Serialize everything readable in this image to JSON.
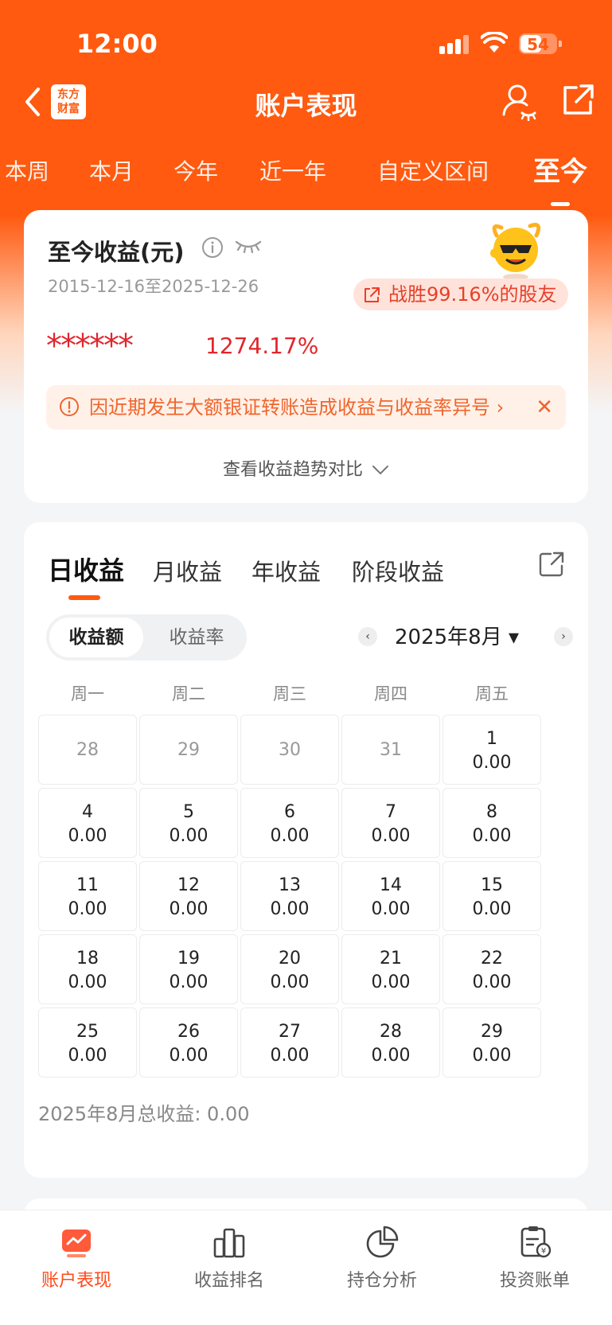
{
  "status": {
    "time": "12:00",
    "battery": "54"
  },
  "nav": {
    "logo": [
      "东方",
      "财富"
    ],
    "title": "账户表现"
  },
  "period_tabs": [
    "本周",
    "本月",
    "今年",
    "近一年",
    "自定义区间",
    "至今"
  ],
  "summary": {
    "title": "至今收益(元)",
    "range": "2015-12-16至2025-12-26",
    "badge": "战胜99.16%的股友",
    "hidden_amount": "******",
    "rate": "1274.17%",
    "notice": "因近期发生大额银证转账造成收益与收益率异号",
    "trend_link": "查看收益趋势对比"
  },
  "calendar": {
    "tabs": [
      "日收益",
      "月收益",
      "年收益",
      "阶段收益"
    ],
    "toggle": [
      "收益额",
      "收益率"
    ],
    "month": "2025年8月",
    "weekdays": [
      "周一",
      "周二",
      "周三",
      "周四",
      "周五"
    ],
    "weeks": [
      [
        {
          "d": "28",
          "v": ""
        },
        {
          "d": "29",
          "v": ""
        },
        {
          "d": "30",
          "v": ""
        },
        {
          "d": "31",
          "v": ""
        },
        {
          "d": "1",
          "v": "0.00"
        }
      ],
      [
        {
          "d": "4",
          "v": "0.00"
        },
        {
          "d": "5",
          "v": "0.00"
        },
        {
          "d": "6",
          "v": "0.00"
        },
        {
          "d": "7",
          "v": "0.00"
        },
        {
          "d": "8",
          "v": "0.00"
        }
      ],
      [
        {
          "d": "11",
          "v": "0.00"
        },
        {
          "d": "12",
          "v": "0.00"
        },
        {
          "d": "13",
          "v": "0.00"
        },
        {
          "d": "14",
          "v": "0.00"
        },
        {
          "d": "15",
          "v": "0.00"
        }
      ],
      [
        {
          "d": "18",
          "v": "0.00"
        },
        {
          "d": "19",
          "v": "0.00"
        },
        {
          "d": "20",
          "v": "0.00"
        },
        {
          "d": "21",
          "v": "0.00"
        },
        {
          "d": "22",
          "v": "0.00"
        }
      ],
      [
        {
          "d": "25",
          "v": "0.00"
        },
        {
          "d": "26",
          "v": "0.00"
        },
        {
          "d": "27",
          "v": "0.00"
        },
        {
          "d": "28",
          "v": "0.00"
        },
        {
          "d": "29",
          "v": "0.00"
        }
      ]
    ],
    "total": "2025年8月总收益: 0.00"
  },
  "bottom_tabs": [
    {
      "label": "账户表现",
      "icon": "performance-icon",
      "active": true
    },
    {
      "label": "收益排名",
      "icon": "ranking-icon",
      "active": false
    },
    {
      "label": "持仓分析",
      "icon": "pie-chart-icon",
      "active": false
    },
    {
      "label": "投资账单",
      "icon": "bill-icon",
      "active": false
    }
  ],
  "colors": {
    "brand": "#ff5a10",
    "red": "#e0262c",
    "notice": "#f0652d"
  }
}
